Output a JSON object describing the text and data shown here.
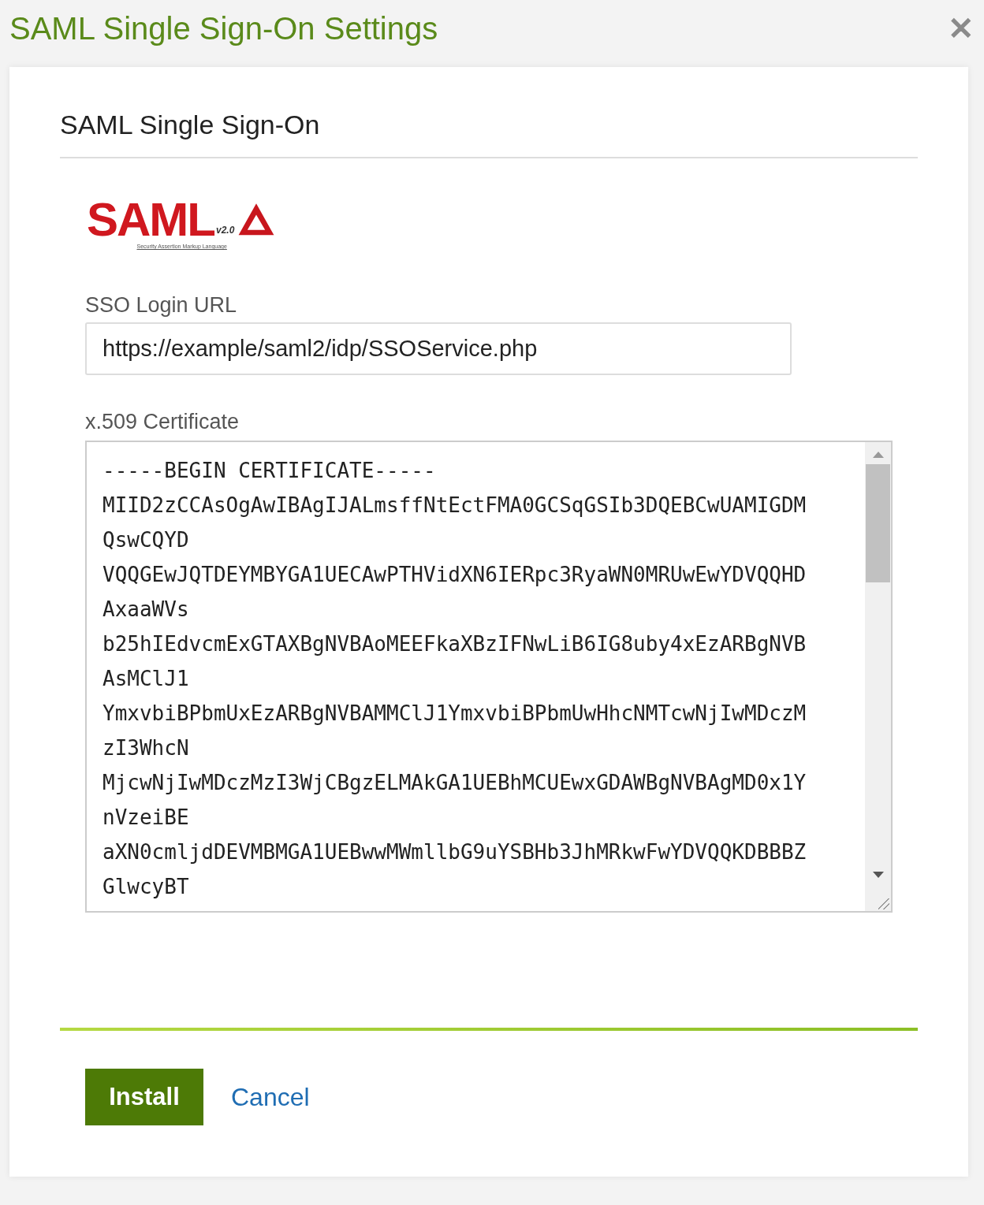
{
  "window": {
    "title": "SAML Single Sign-On Settings",
    "close": "✕"
  },
  "card": {
    "heading": "SAML Single Sign-On",
    "logo": {
      "word": "SAML",
      "version": "v2.0",
      "tagline": "Security Assertion Markup Language"
    },
    "fields": [
      {
        "kind": "input",
        "label": "SSO Login URL",
        "value": "https://example/saml2/idp/SSOService.php"
      },
      {
        "kind": "textarea",
        "label": "x.509 Certificate",
        "lines": [
          "-----BEGIN CERTIFICATE-----",
          "MIID2zCCAsOgAwIBAgIJALmsffNtEctFMA0GCSqGSIb3DQEBCwUAMIGDM",
          "QswCQYD",
          "VQQGEwJQTDEYMBYGA1UECAwPTHVidXN6IERpc3RyaWN0MRUwEwYDVQQHD",
          "AxaaWVs",
          "b25hIEdvcmExGTAXBgNVBAoMEEFkaXBzIFNwLiB6IG8uby4xEzARBgNVB",
          "AsMClJ1",
          "YmxvbiBPbmUxEzARBgNVBAMMClJ1YmxvbiBPbmUwHhcNMTcwNjIwMDczM",
          "zI3WhcN",
          "MjcwNjIwMDczMzI3WjCBgzELMAkGA1UEBhMCUEwxGDAWBgNVBAgMD0x1Y",
          "nVzeiBE",
          "aXN0cmljdDEVMBMGA1UEBwwMWmllbG9uYSBHb3JhMRkwFwYDVQQKDBBBZ",
          "GlwcyBT"
        ]
      }
    ],
    "buttons": [
      {
        "kind": "primary",
        "label": "Install"
      },
      {
        "kind": "link",
        "label": "Cancel"
      }
    ]
  }
}
